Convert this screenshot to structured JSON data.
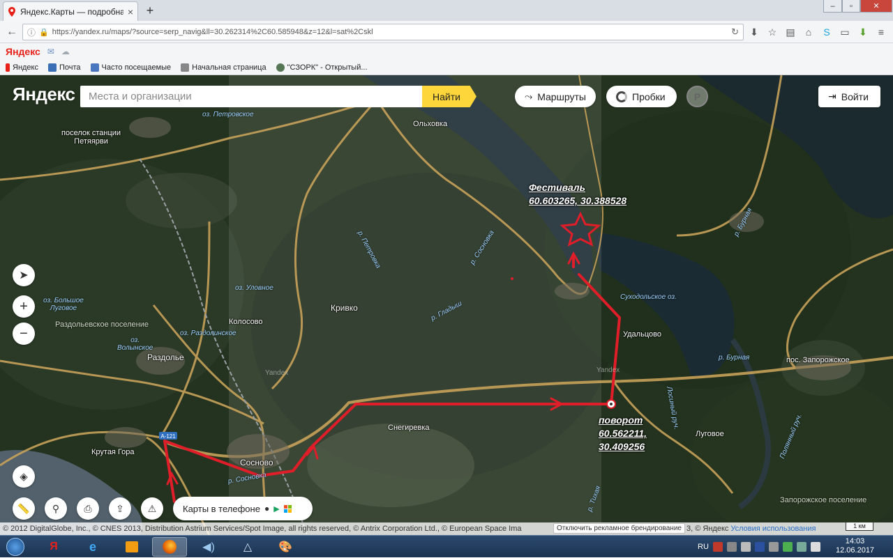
{
  "browser": {
    "tab_title": "Яндекс.Карты — подробная",
    "url": "https://yandex.ru/maps/?source=serp_navig&ll=30.262314%2C60.585948&z=12&l=sat%2Cskl",
    "yandex_bar_logo": "Яндекс",
    "bookmarks": [
      {
        "label": "Яндекс",
        "color": "#e8201a"
      },
      {
        "label": "Почта",
        "color": "#3b6fb5"
      },
      {
        "label": "Часто посещаемые",
        "color": "#4a78c0"
      },
      {
        "label": "Начальная страница",
        "color": "#666666"
      },
      {
        "label": "\"СЗОРК\" - Открытый...",
        "color": "#557755"
      }
    ]
  },
  "map_ui": {
    "logo": "Яндекс",
    "search_placeholder": "Места и организации",
    "find_button": "Найти",
    "routes_button": "Маршруты",
    "traffic_button": "Пробки",
    "parking_label": "P",
    "login_button": "Войти",
    "phone_promo": "Карты в телефоне",
    "copyright": "© 2012 DigitalGlobe, Inc., © CNES 2013, Distribution Astrium Services/Spot Image, all rights reserved, © Antrix Corporation Ltd., © European Space Ima",
    "copyright_tail": "3, © Яндекс",
    "terms_link": "Условия использования",
    "unbrand_button": "Отключить рекламное брендирование",
    "scale_label": "1 км",
    "highway_label": "А-121",
    "watermark": "Yandex"
  },
  "places": [
    {
      "id": "olkhovka",
      "name": "Ольховка"
    },
    {
      "id": "petyayarvi",
      "name": "поселок станции\nПетяярви"
    },
    {
      "id": "krivko",
      "name": "Кривко"
    },
    {
      "id": "kolosovo",
      "name": "Колосово"
    },
    {
      "id": "razdolye",
      "name": "Раздолье"
    },
    {
      "id": "udaltsovo",
      "name": "Удальцово"
    },
    {
      "id": "zaporozhskoe",
      "name": "пос. Запорожское"
    },
    {
      "id": "snegirevka",
      "name": "Снегиревка"
    },
    {
      "id": "krutaya",
      "name": "Крутая Гора"
    },
    {
      "id": "sosnovo",
      "name": "Сосново"
    },
    {
      "id": "lugovoe",
      "name": "Луговое"
    }
  ],
  "water_labels": [
    {
      "id": "petrovskoe",
      "name": "оз. Петровское"
    },
    {
      "id": "lugovoe_lake",
      "name": "оз. Большое\nЛуговое"
    },
    {
      "id": "ulovnoe",
      "name": "оз. Уловное"
    },
    {
      "id": "razdolinskoe",
      "name": "оз. Раздолинское"
    },
    {
      "id": "volynskoe",
      "name": "оз.\nВолынское"
    },
    {
      "id": "sukhodolskoe",
      "name": "Суходольское оз."
    },
    {
      "id": "petrovka",
      "name": "р. Петровка"
    },
    {
      "id": "sosnovka",
      "name": "р. Сосновка"
    },
    {
      "id": "gladysh",
      "name": "р. Гладыш"
    },
    {
      "id": "burnaya1",
      "name": "р. Бурная"
    },
    {
      "id": "burnaya2",
      "name": "р. Бурная"
    },
    {
      "id": "losiny",
      "name": "Лосиный руч."
    },
    {
      "id": "polyanny",
      "name": "Полянный руч."
    },
    {
      "id": "sosnovka2",
      "name": "р. Сосновка"
    },
    {
      "id": "tikhaya",
      "name": "р. Тихая"
    }
  ],
  "areas": [
    {
      "id": "razdolyevskoe",
      "name": "Раздольевское поселение"
    },
    {
      "id": "zaporozhskoe_pos",
      "name": "Запорожское поселение"
    }
  ],
  "annotations": {
    "festival_title": "Фестиваль",
    "festival_coords": "60.603265, 30.388528",
    "turn_title": "поворот",
    "turn_lat": "60.562211,",
    "turn_lon": "30.409256"
  },
  "colors": {
    "route": "#e01e2a",
    "road": "#c8a25a",
    "search_button": "#fcd63a",
    "taskbar": "#1b3251"
  },
  "taskbar": {
    "lang": "RU",
    "time": "14:03",
    "date": "12.06.2017"
  }
}
